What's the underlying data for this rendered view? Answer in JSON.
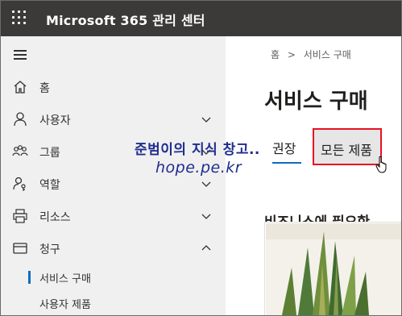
{
  "header": {
    "app_title": "Microsoft 365 관리 센터",
    "waffle_icon": "waffle-icon"
  },
  "sidebar": {
    "menu_icon": "hamburger-icon",
    "items": [
      {
        "label": "홈",
        "icon": "home-icon",
        "expandable": false
      },
      {
        "label": "사용자",
        "icon": "person-icon",
        "expandable": true,
        "expanded": false
      },
      {
        "label": "그룹",
        "icon": "group-icon",
        "expandable": true,
        "expanded": false
      },
      {
        "label": "역할",
        "icon": "role-icon",
        "expandable": true,
        "expanded": false
      },
      {
        "label": "리소스",
        "icon": "printer-icon",
        "expandable": true,
        "expanded": false
      },
      {
        "label": "청구",
        "icon": "card-icon",
        "expandable": true,
        "expanded": true
      }
    ],
    "subitems": [
      {
        "label": "서비스 구매",
        "selected": true
      },
      {
        "label": "사용자 제품",
        "selected": false
      }
    ]
  },
  "main": {
    "breadcrumb": {
      "home": "홈",
      "separator": ">",
      "current": "서비스 구매"
    },
    "page_title": "서비스 구매",
    "tabs": [
      {
        "label": "권장",
        "active": true
      },
      {
        "label": "모든 제품",
        "active": false,
        "highlighted": true
      }
    ],
    "section_title": "비즈니스에 필요한",
    "accent_color": "#0f6cbd",
    "highlight_color": "#e81123"
  },
  "watermark": {
    "line1": "준범이의 지식 창고..",
    "line2": "hope.pe.kr"
  }
}
